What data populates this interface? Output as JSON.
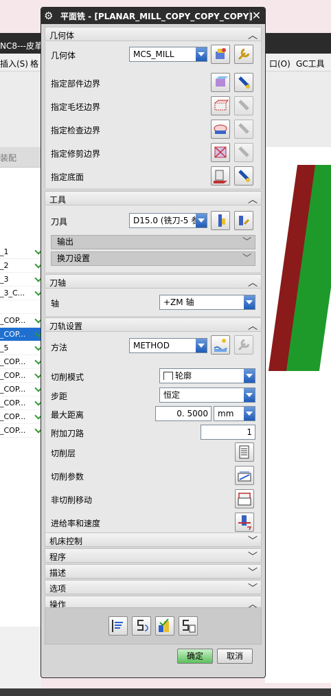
{
  "background": {
    "window_title": "NC8---皮革",
    "menus": [
      "插入(S)",
      "格",
      "口(O)",
      "GC工具箱"
    ],
    "nav_tab": "装配",
    "nav_rows": [
      {
        "text": "_1",
        "sel": false,
        "check": true
      },
      {
        "text": "_2",
        "sel": false,
        "check": true
      },
      {
        "text": "_3",
        "sel": false,
        "check": true
      },
      {
        "text": "_3_C...",
        "sel": false,
        "check": true
      },
      {
        "text": "",
        "sel": false,
        "check": false
      },
      {
        "text": "_COP...",
        "sel": false,
        "check": true
      },
      {
        "text": "_COP...",
        "sel": true,
        "check": true
      },
      {
        "text": "_5",
        "sel": false,
        "check": true
      },
      {
        "text": "_COP...",
        "sel": false,
        "check": true
      },
      {
        "text": "_COP...",
        "sel": false,
        "check": true
      },
      {
        "text": "_COP...",
        "sel": false,
        "check": true
      },
      {
        "text": "_COP...",
        "sel": false,
        "check": true
      },
      {
        "text": "_COP...",
        "sel": false,
        "check": true
      },
      {
        "text": "_COP...",
        "sel": false,
        "check": true
      }
    ]
  },
  "dialog": {
    "title": "平面铣 - [PLANAR_MILL_COPY_COPY_COPY]",
    "sections": {
      "geometry": {
        "title": "几何体",
        "geometry_label": "几何体",
        "geometry_value": "MCS_MILL",
        "rows": [
          "指定部件边界",
          "指定毛坯边界",
          "指定检查边界",
          "指定修剪边界",
          "指定底面"
        ]
      },
      "tool": {
        "title": "工具",
        "tool_label": "刀具",
        "tool_value": "D15.0 (铣刀-5 参",
        "output_label": "输出",
        "change_label": "换刀设置"
      },
      "axis": {
        "title": "刀轴",
        "axis_label": "轴",
        "axis_value": "+ZM 轴"
      },
      "path": {
        "title": "刀轨设置",
        "method_label": "方法",
        "method_value": "METHOD",
        "cut_mode_label": "切削模式",
        "cut_mode_value": "轮廓",
        "stepover_label": "步距",
        "stepover_value": "恒定",
        "max_dist_label": "最大距离",
        "max_dist_value": "0. 5000",
        "max_dist_unit": "mm",
        "extra_paths_label": "附加刀路",
        "extra_paths_value": "1",
        "cut_levels_label": "切削层",
        "cut_params_label": "切削参数",
        "noncut_label": "非切削移动",
        "feeds_label": "进给率和速度"
      },
      "collapsed": [
        "机床控制",
        "程序",
        "描述",
        "选项"
      ],
      "operation": {
        "title": "操作"
      }
    },
    "ok_label": "确定",
    "cancel_label": "取消"
  }
}
